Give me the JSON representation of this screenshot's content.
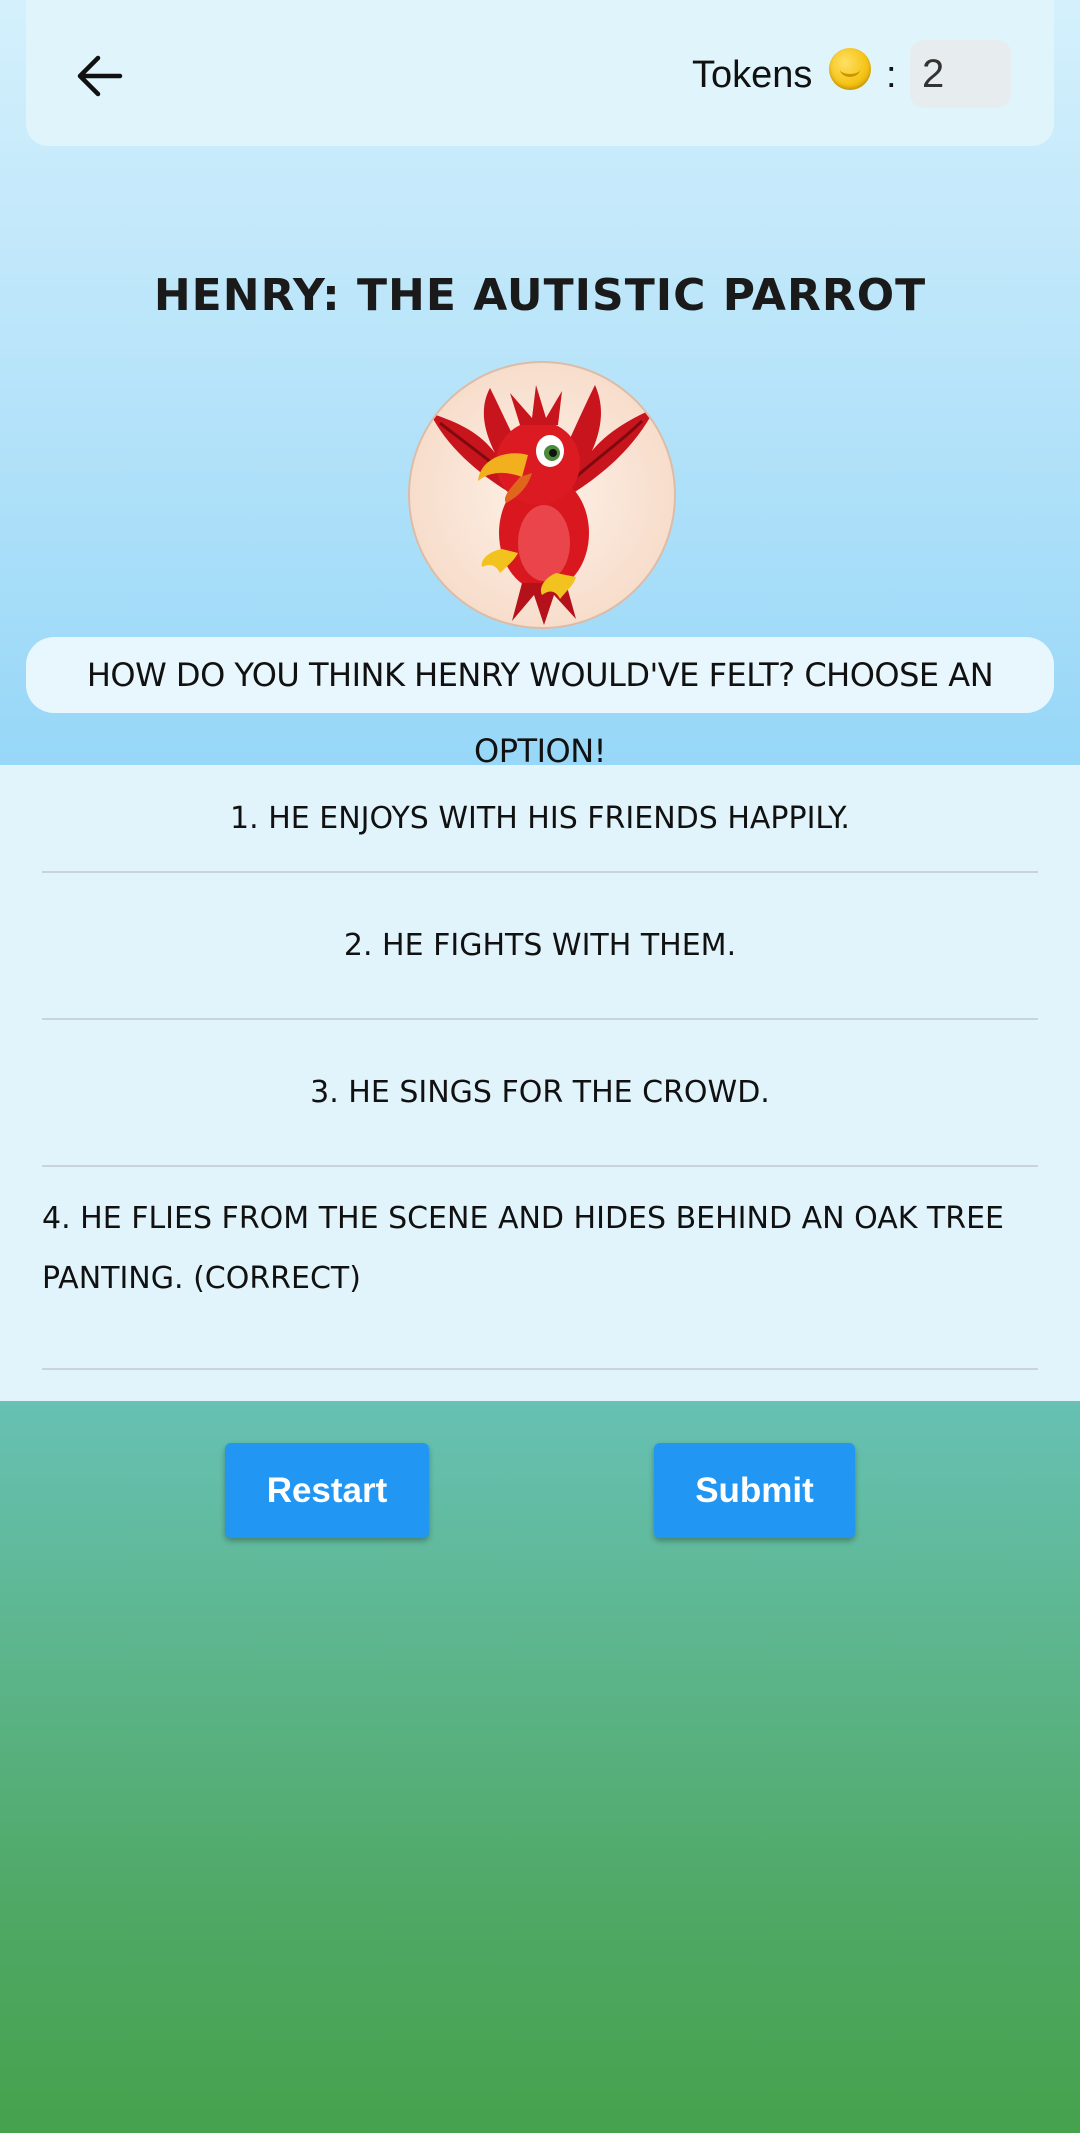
{
  "header": {
    "tokens_label": "Tokens",
    "colon": ":",
    "token_count": "2"
  },
  "story": {
    "title": "Henry: the Autistic Parrot",
    "question": "How do you think Henry would've felt? Choose an option!"
  },
  "options": [
    {
      "label": "1. He enjoys with his friends happily."
    },
    {
      "label": "2. He fights with them."
    },
    {
      "label": "3. He sings for the crowd."
    },
    {
      "label": "4. He flies from the scene and hides behind an oak tree panting. (correct)"
    }
  ],
  "actions": {
    "restart_label": "Restart",
    "submit_label": "Submit"
  },
  "icons": {
    "back": "arrow-left-icon",
    "coin": "coin-icon",
    "parrot": "parrot-image"
  },
  "colors": {
    "primary_button": "#2196f3",
    "header_card": "#e0f4fc",
    "options_bg": "#e1f4fc"
  }
}
